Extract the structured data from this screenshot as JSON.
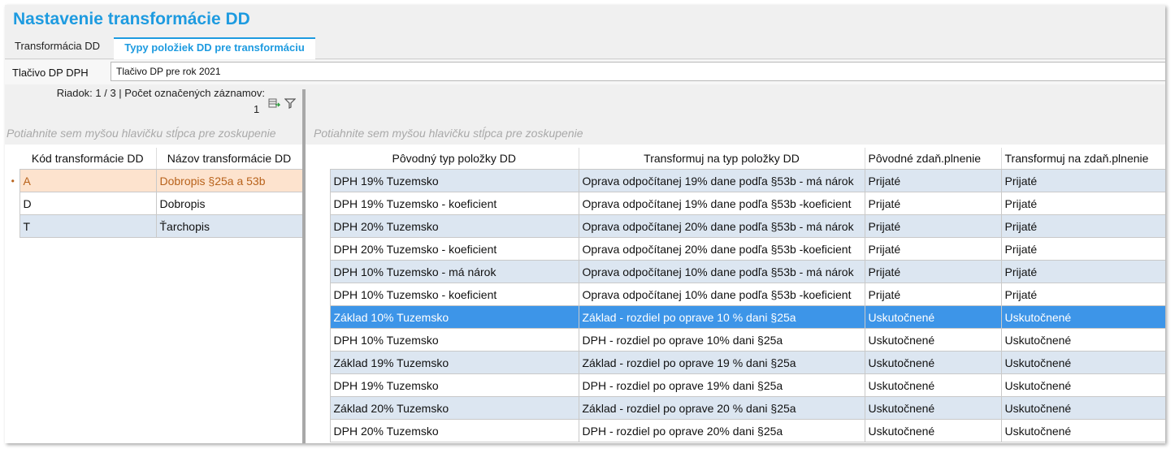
{
  "title": "Nastavenie transformácie DD",
  "tabs": [
    {
      "label": "Transformácia DD"
    },
    {
      "label": "Typy položiek DD pre transformáciu"
    }
  ],
  "field": {
    "label": "Tlačivo DP DPH",
    "value": "Tlačivo DP pre rok 2021"
  },
  "left": {
    "status": "Riadok: 1 / 3 | Počet označených záznamov:",
    "count": "1",
    "group_hint": "Potiahnite sem myšou hlavičku stĺpca pre zoskupenie",
    "columns": [
      "Kód transformácie DD",
      "Názov transformácie DD"
    ],
    "rows": [
      {
        "code": "A",
        "name": "Dobropis §25a a 53b"
      },
      {
        "code": "D",
        "name": "Dobropis"
      },
      {
        "code": "T",
        "name": "Ťarchopis"
      }
    ],
    "row_indicator": "•"
  },
  "right": {
    "group_hint": "Potiahnite sem myšou hlavičku stĺpca pre zoskupenie",
    "columns": [
      "Pôvodný typ položky DD",
      "Transformuj na typ položky DD",
      "Pôvodné zdaň.plnenie",
      "Transformuj na zdaň.plnenie"
    ],
    "rows": [
      {
        "orig": "DPH 19% Tuzemsko",
        "target": "Oprava odpočítanej 19% dane podľa §53b - má nárok",
        "orig_plnenie": "Prijaté",
        "target_plnenie": "Prijaté"
      },
      {
        "orig": "DPH 19% Tuzemsko - koeficient",
        "target": "Oprava odpočítanej 19% dane podľa §53b -koeficient",
        "orig_plnenie": "Prijaté",
        "target_plnenie": "Prijaté"
      },
      {
        "orig": "DPH 20% Tuzemsko",
        "target": "Oprava odpočítanej 20% dane podľa §53b - má nárok",
        "orig_plnenie": "Prijaté",
        "target_plnenie": "Prijaté"
      },
      {
        "orig": "DPH 20% Tuzemsko - koeficient",
        "target": "Oprava odpočítanej 20% dane podľa §53b -koeficient",
        "orig_plnenie": "Prijaté",
        "target_plnenie": "Prijaté"
      },
      {
        "orig": "DPH 10% Tuzemsko - má nárok",
        "target": "Oprava odpočítanej 10% dane podľa §53b - má nárok",
        "orig_plnenie": "Prijaté",
        "target_plnenie": "Prijaté"
      },
      {
        "orig": "DPH 10% Tuzemsko - koeficient",
        "target": "Oprava odpočítanej 10% dane podľa §53b -koeficient",
        "orig_plnenie": "Prijaté",
        "target_plnenie": "Prijaté"
      },
      {
        "orig": "Základ 10% Tuzemsko",
        "target": "Základ - rozdiel po oprave 10 % dani §25a",
        "orig_plnenie": "Uskutočnené",
        "target_plnenie": "Uskutočnené"
      },
      {
        "orig": "DPH 10% Tuzemsko",
        "target": "DPH - rozdiel po oprave 10% dani §25a",
        "orig_plnenie": "Uskutočnené",
        "target_plnenie": "Uskutočnené"
      },
      {
        "orig": "Základ 19% Tuzemsko",
        "target": "Základ - rozdiel po oprave 19 % dani §25a",
        "orig_plnenie": "Uskutočnené",
        "target_plnenie": "Uskutočnené"
      },
      {
        "orig": "DPH 19% Tuzemsko",
        "target": "DPH - rozdiel po oprave 19% dani §25a",
        "orig_plnenie": "Uskutočnené",
        "target_plnenie": "Uskutočnené"
      },
      {
        "orig": "Základ 20% Tuzemsko",
        "target": "Základ - rozdiel po oprave 20 % dani §25a",
        "orig_plnenie": "Uskutočnené",
        "target_plnenie": "Uskutočnené"
      },
      {
        "orig": "DPH 20% Tuzemsko",
        "target": "DPH - rozdiel po oprave 20% dani §25a",
        "orig_plnenie": "Uskutočnené",
        "target_plnenie": "Uskutočnené"
      }
    ],
    "row_indicator": "•"
  },
  "icons": {
    "export": "export-grid-icon",
    "filter": "filter-icon"
  },
  "colors": {
    "accent": "#1e9be0",
    "selected_row": "#3d95e8",
    "alt_row": "#dce6f1",
    "focus_row": "#fde3ce"
  }
}
